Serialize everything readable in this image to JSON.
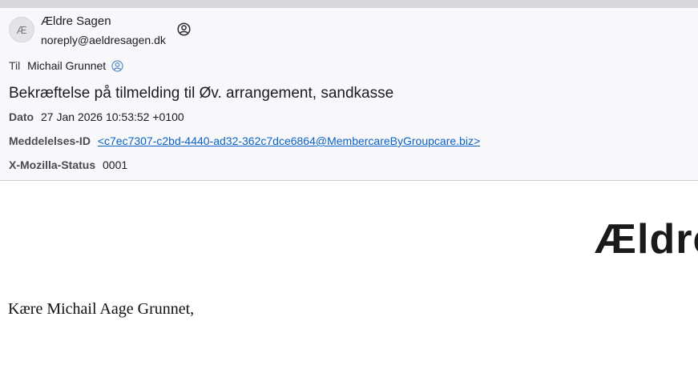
{
  "header": {
    "avatar_letter": "Æ",
    "sender_name": "Ældre Sagen",
    "sender_email": "noreply@aeldresagen.dk",
    "to_label": "Til",
    "to_value": "Michail Grunnet",
    "subject": "Bekræftelse på tilmelding til Øv. arrangement, sandkasse",
    "date_label": "Dato",
    "date_value": "27 Jan 2026 10:53:52 +0100",
    "message_id_label": "Meddelelses-ID",
    "message_id_value": "<c7ec7307-c2bd-4440-ad32-362c7dce6864@MembercareByGroupcare.biz>",
    "mozilla_status_label": "X-Mozilla-Status",
    "mozilla_status_value": "0001"
  },
  "body": {
    "logo_text": "Ældre",
    "greeting": "Kære Michail Aage Grunnet,"
  },
  "colors": {
    "link": "#0a62c9",
    "header_background": "#f8f8fa"
  }
}
